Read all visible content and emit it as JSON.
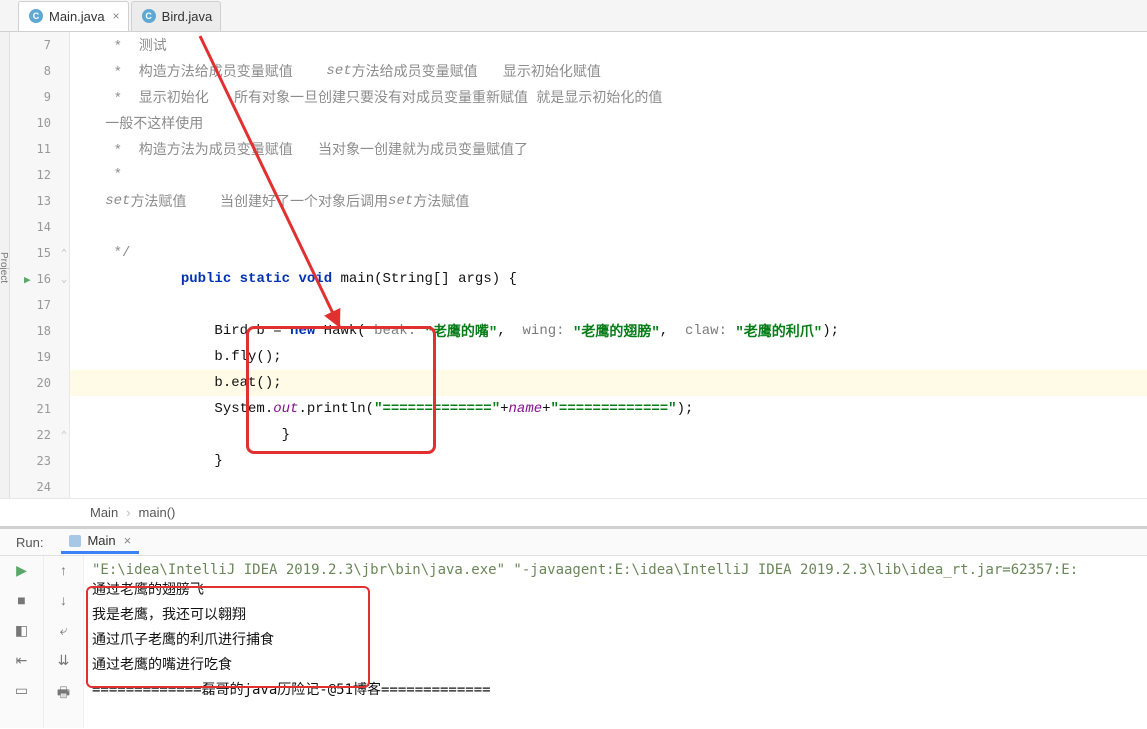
{
  "tabs": [
    {
      "icon": "C",
      "label": "Main.java",
      "close": "×"
    },
    {
      "icon": "C",
      "label": "Bird.java"
    }
  ],
  "left_label": "Project",
  "gutter": {
    "7": "7",
    "8": "8",
    "9": "9",
    "10": "10",
    "11": "11",
    "12": "12",
    "13": "13",
    "14": "14",
    "15": "15",
    "16": "16",
    "17": "17",
    "18": "18",
    "19": "19",
    "20": "20",
    "21": "21",
    "22": "22",
    "23": "23",
    "24": "24"
  },
  "code": {
    "l7": "    *  测试",
    "l8a": "    *  构造方法给成员变量赋值    ",
    "l8b": "set",
    "l8c": "方法给成员变量赋值   显示初始化赋值",
    "l9": "    *  显示初始化   所有对象一旦创建只要没有对成员变量重新赋值 就是显示初始化的值",
    "l10": "   一般不这样使用",
    "l11": "    *  构造方法为成员变量赋值   当对象一创建就为成员变量赋值了",
    "l12": "    *",
    "l13a": "   ",
    "l13b": "set",
    "l13c": "方法赋值    当创建好了一个对象后调用",
    "l13d": "set",
    "l13e": "方法赋值",
    "l14": "",
    "l15": "    */",
    "l16_kw1": "public",
    "l16_kw2": "static",
    "l16_kw3": "void",
    "l16_rest": " main(String[] args) {",
    "l17": "",
    "l18_a": "Bird b = ",
    "l18_new": "new",
    "l18_b": " Hawk(",
    "l18_pb": " beak: ",
    "l18_s1": "\"老鹰的嘴\"",
    "l18_c1": ", ",
    "l18_pw": " wing: ",
    "l18_s2": "\"老鹰的翅膀\"",
    "l18_c2": ", ",
    "l18_pc": " claw: ",
    "l18_s3": "\"老鹰的利爪\"",
    "l18_end": ");",
    "l19": "b.fly();",
    "l20": "b.eat();",
    "l21_a": "System.",
    "l21_out": "out",
    "l21_b": ".println(",
    "l21_s1": "\"=============\"",
    "l21_p": "+",
    "l21_name": "name",
    "l21_p2": "+",
    "l21_s2": "\"=============\"",
    "l21_end": ");",
    "l22": "        }",
    "l23": "}",
    "l24": ""
  },
  "breadcrumb": {
    "a": "Main",
    "b": "main()"
  },
  "run": {
    "label": "Run:",
    "tab": "Main",
    "close": "×"
  },
  "console": {
    "cmd": "\"E:\\idea\\IntelliJ IDEA 2019.2.3\\jbr\\bin\\java.exe\" \"-javaagent:E:\\idea\\IntelliJ IDEA 2019.2.3\\lib\\idea_rt.jar=62357:E:",
    "l1": "通过老鹰的翅膀飞",
    "l2": "我是老鹰，我还可以翱翔",
    "l3": "通过爪子老鹰的利爪进行捕食",
    "l4": "通过老鹰的嘴进行吃食",
    "l5": "=============磊哥的java历险记-@51博客============="
  },
  "colors": {
    "red": "#e03030"
  }
}
